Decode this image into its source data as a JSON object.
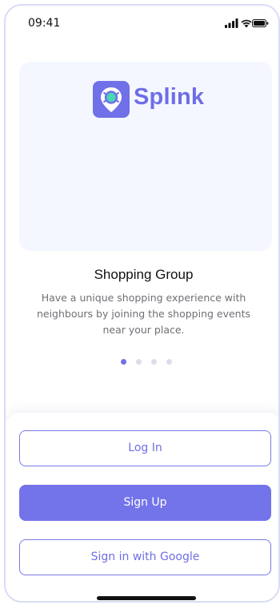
{
  "status_bar": {
    "time": "09:41",
    "icons": [
      "signal-icon",
      "wifi-icon",
      "battery-icon"
    ]
  },
  "brand": {
    "name": "Splink",
    "mark_icon": "location-pin-icon",
    "color": "#7070e8"
  },
  "onboarding": {
    "title": "Shopping Group",
    "description": "Have a unique shopping experience with neighbours by joining the shopping events near your place.",
    "pages_total": 4,
    "current_page": 1
  },
  "actions": {
    "login_label": "Log In",
    "signup_label": "Sign Up",
    "google_label": "Sign in with Google"
  },
  "colors": {
    "accent": "#7373ea",
    "hero_bg": "#f4f7ff",
    "text_secondary": "#6f6f75"
  }
}
